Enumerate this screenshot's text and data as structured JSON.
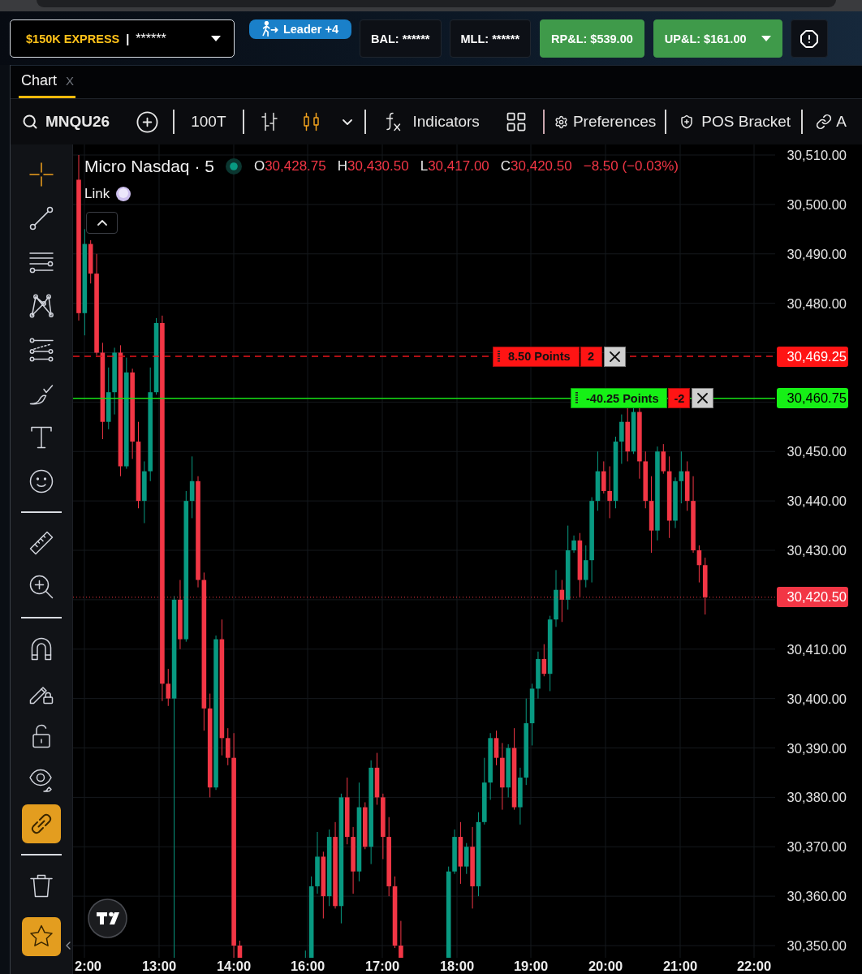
{
  "header": {
    "account": {
      "name": "$150K EXPRESS",
      "separator": "|",
      "masked_number": "******"
    },
    "leader_badge": "Leader +4",
    "stats": [
      {
        "label": "BAL: ******",
        "kind": "neutral",
        "dropdown": false
      },
      {
        "label": "MLL: ******",
        "kind": "neutral",
        "dropdown": false
      },
      {
        "label": "RP&L: $539.00",
        "kind": "profit",
        "dropdown": false
      },
      {
        "label": "UP&L: $161.00",
        "kind": "profit",
        "dropdown": true
      }
    ]
  },
  "tabs": [
    {
      "label": "Chart",
      "close": "X",
      "selected": true
    }
  ],
  "toolbar": {
    "symbol": "MNQU26",
    "interval": "100T",
    "chart_styles": [
      {
        "selected": false
      },
      {
        "selected": true
      }
    ],
    "indicators": "Indicators",
    "preferences": "Preferences",
    "bracket": "POS Bracket",
    "link_label": "A"
  },
  "left_toolbar": [
    {
      "kind": "tool",
      "selected": true
    },
    {
      "kind": "tool",
      "selected": false
    },
    {
      "kind": "tool",
      "selected": false
    },
    {
      "kind": "tool",
      "selected": false
    },
    {
      "kind": "tool",
      "selected": false
    },
    {
      "kind": "tool",
      "selected": false
    },
    {
      "kind": "tool",
      "selected": false
    },
    {
      "kind": "tool",
      "selected": false
    },
    {
      "kind": "divider"
    },
    {
      "kind": "tool",
      "selected": false
    },
    {
      "kind": "tool",
      "selected": false
    },
    {
      "kind": "divider"
    },
    {
      "kind": "toggle",
      "on": false
    },
    {
      "kind": "toggle",
      "on": false
    },
    {
      "kind": "toggle",
      "on": false
    },
    {
      "kind": "toggle",
      "on": false
    },
    {
      "kind": "toggle",
      "on": true
    },
    {
      "kind": "divider"
    },
    {
      "kind": "action"
    }
  ],
  "favorites": {
    "on": true
  },
  "legend": {
    "title": "Micro Nasdaq · 5",
    "market_open": true,
    "ohlc": [
      {
        "key": "O",
        "value": "30,428.75"
      },
      {
        "key": "H",
        "value": "30,430.50"
      },
      {
        "key": "L",
        "value": "30,417.00"
      },
      {
        "key": "C",
        "value": "30,420.50"
      }
    ],
    "change": "−8.50 (−0.03%)",
    "link": "Link"
  },
  "orders": [
    {
      "kind": "stop",
      "points": "8.50 Points",
      "quantity": "2",
      "price": "30,469.25"
    },
    {
      "kind": "position",
      "points": "-40.25 Points",
      "quantity": "-2",
      "price": "30,460.75"
    }
  ],
  "last_price": "30,420.50",
  "price_axis": [
    "30,510.00",
    "30,500.00",
    "30,490.00",
    "30,480.00",
    "30,450.00",
    "30,440.00",
    "30,430.00",
    "30,410.00",
    "30,400.00",
    "30,390.00",
    "30,380.00",
    "30,370.00",
    "30,360.00",
    "30,350.00"
  ],
  "time_axis": [
    "2:00",
    "13:00",
    "14:00",
    "16:00",
    "17:00",
    "18:00",
    "19:00",
    "20:00",
    "21:00",
    "22:00"
  ]
}
